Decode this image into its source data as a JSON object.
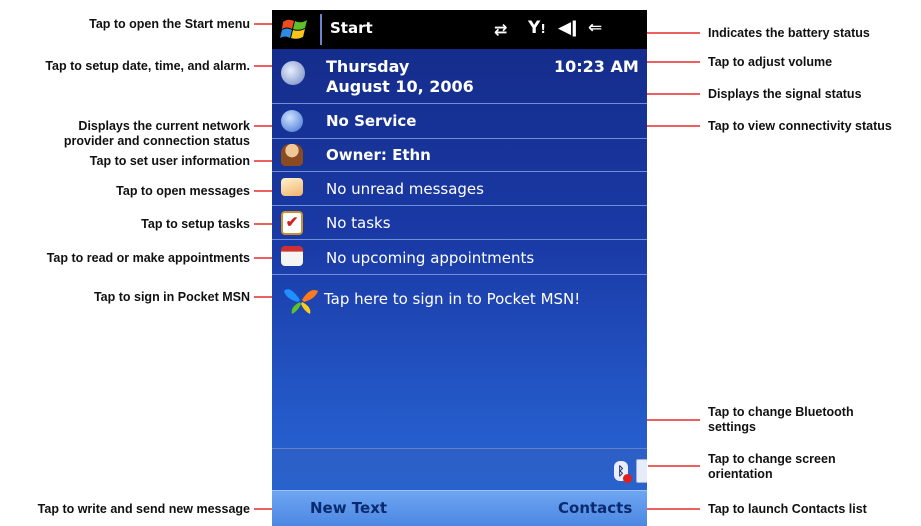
{
  "annotations_left": [
    {
      "id": "start",
      "text": "Tap to open the Start menu"
    },
    {
      "id": "date",
      "text": "Tap to setup date, time, and alarm."
    },
    {
      "id": "network",
      "text": "Displays the current network\nprovider and connection status"
    },
    {
      "id": "owner",
      "text": "Tap to set user information"
    },
    {
      "id": "messages",
      "text": "Tap to open messages"
    },
    {
      "id": "tasks",
      "text": "Tap to setup tasks"
    },
    {
      "id": "appointments",
      "text": "Tap to read or make appointments"
    },
    {
      "id": "msn",
      "text": "Tap to sign in Pocket MSN"
    },
    {
      "id": "newtext",
      "text": "Tap to write and send new message"
    }
  ],
  "annotations_right": [
    {
      "id": "battery",
      "text": "Indicates the battery status"
    },
    {
      "id": "volume",
      "text": "Tap to adjust volume"
    },
    {
      "id": "signal",
      "text": "Displays the signal status"
    },
    {
      "id": "connectivity",
      "text": "Tap to view connectivity status"
    },
    {
      "id": "bluetooth",
      "text": "Tap to change Bluetooth\nsettings"
    },
    {
      "id": "orientation",
      "text": "Tap to change screen\norientation"
    },
    {
      "id": "contacts",
      "text": "Tap to launch Contacts list"
    }
  ],
  "device": {
    "title": "Start",
    "time": "10:23 AM",
    "date_line1": "Thursday",
    "date_line2": "August 10, 2006",
    "network": "No Service",
    "owner": "Owner: Ethn",
    "messages": "No unread messages",
    "tasks": "No tasks",
    "appointments": "No upcoming appointments",
    "msn": "Tap here to sign in to Pocket MSN!",
    "softkey_left": "New Text",
    "softkey_right": "Contacts"
  },
  "icons": [
    "windows-flag-icon",
    "connectivity-icon",
    "signal-icon",
    "volume-icon",
    "battery-icon",
    "clock-icon",
    "globe-icon",
    "owner-icon",
    "envelope-icon",
    "tasks-icon",
    "calendar-icon",
    "msn-butterfly-icon",
    "bluetooth-icon",
    "screen-rotate-icon"
  ],
  "colors": {
    "accent": "#1a3aa6",
    "titlebar": "#000000",
    "softbar": "#4a86e2",
    "callout_line": "#e00000"
  }
}
